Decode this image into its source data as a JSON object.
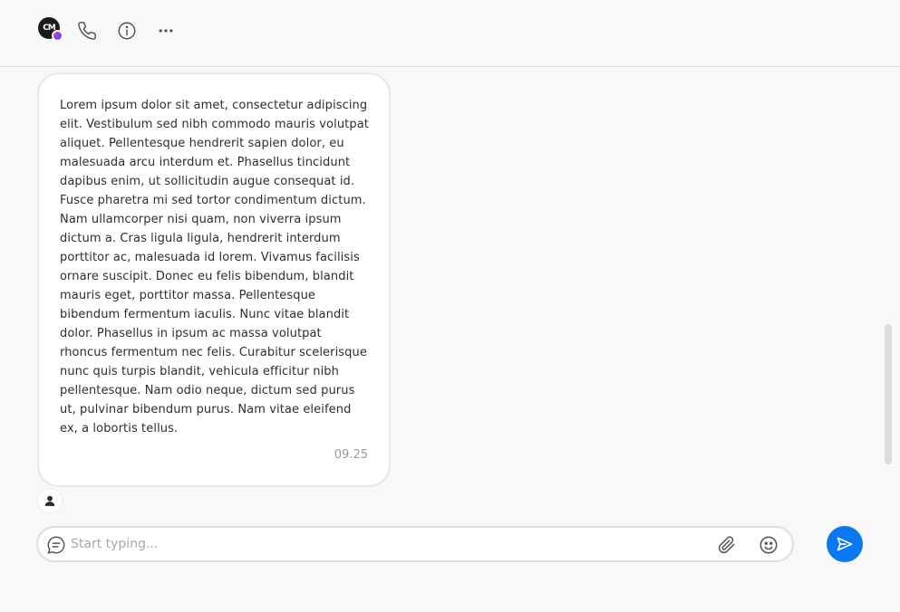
{
  "header": {
    "logo_text": "CM",
    "icons": [
      "phone-icon",
      "info-icon",
      "more-icon"
    ]
  },
  "message": {
    "text": "Lorem ipsum dolor sit amet, consectetur adipiscing elit. Vestibulum sed nibh commodo mauris volutpat aliquet. Pellentesque hendrerit sapien dolor, eu malesuada arcu interdum et. Phasellus tincidunt dapibus enim, ut sollicitudin augue consequat id. Fusce pharetra mi sed tortor condimentum dictum. Nam ullamcorper nisi quam, non viverra ipsum dictum a. Cras ligula ligula, hendrerit interdum porttitor ac, malesuada id lorem. Vivamus facilisis ornare suscipit. Donec eu felis bibendum, blandit mauris eget, porttitor massa. Pellentesque bibendum fermentum iaculis. Nunc vitae blandit dolor. Phasellus in ipsum ac massa volutpat rhoncus fermentum nec felis. Curabitur scelerisque nunc quis turpis blandit, vehicula efficitur nibh pellentesque. Nam odio neque, dictum sed purus ut, pulvinar bibendum purus. Nam vitae eleifend ex, a lobortis tellus.",
    "time": "09.25"
  },
  "composer": {
    "value": "",
    "placeholder": "Start typing..."
  },
  "colors": {
    "accent": "#0a78f0",
    "background": "#f8f8f8",
    "bubble": "#ffffff",
    "border": "#e2e2e2"
  }
}
